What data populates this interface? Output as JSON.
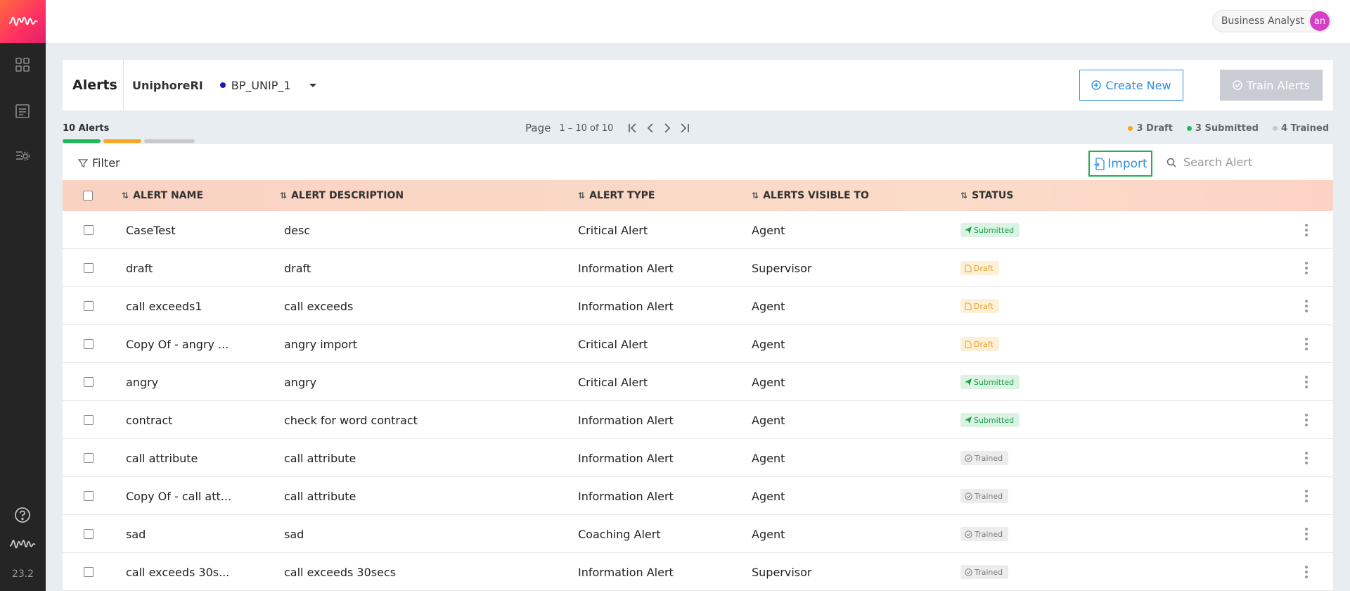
{
  "sidebar": {
    "icons": [
      "logo-icon",
      "dashboard-icon",
      "list-icon",
      "settings-list-icon"
    ],
    "version": "23.2"
  },
  "topbar": {
    "role": "Business Analyst",
    "avatar_initials": "an"
  },
  "header": {
    "title": "Alerts",
    "project": "UniphoreRI",
    "workspace": "BP_UNIP_1",
    "create_label": "Create New",
    "train_label": "Train Alerts"
  },
  "summary": {
    "count_label": "10 Alerts",
    "page_label": "Page",
    "page_range": "1 – 10 of 10",
    "legend": [
      {
        "label": "3 Draft",
        "color": "#f5a623"
      },
      {
        "label": "3 Submitted",
        "color": "#1db954"
      },
      {
        "label": "4 Trained",
        "color": "#c8c8c8"
      }
    ]
  },
  "toolbar": {
    "filter_label": "Filter",
    "import_label": "Import",
    "search_placeholder": "Search Alert"
  },
  "table": {
    "columns": [
      "ALERT NAME",
      "ALERT DESCRIPTION",
      "ALERT TYPE",
      "ALERTS VISIBLE TO",
      "STATUS"
    ],
    "rows": [
      {
        "name": "CaseTest",
        "description": "desc",
        "type": "Critical Alert",
        "visible": "Agent",
        "status": "Submitted"
      },
      {
        "name": "draft",
        "description": "draft",
        "type": "Information Alert",
        "visible": "Supervisor",
        "status": "Draft"
      },
      {
        "name": "call exceeds1",
        "description": "call exceeds",
        "type": "Information Alert",
        "visible": "Agent",
        "status": "Draft"
      },
      {
        "name": "Copy Of - angry ...",
        "description": "angry import",
        "type": "Critical Alert",
        "visible": "Agent",
        "status": "Draft"
      },
      {
        "name": "angry",
        "description": "angry",
        "type": "Critical Alert",
        "visible": "Agent",
        "status": "Submitted"
      },
      {
        "name": "contract",
        "description": "check for word contract",
        "type": "Information Alert",
        "visible": "Agent",
        "status": "Submitted"
      },
      {
        "name": "call attribute",
        "description": "call attribute",
        "type": "Information Alert",
        "visible": "Agent",
        "status": "Trained"
      },
      {
        "name": "Copy Of - call att...",
        "description": "call attribute",
        "type": "Information Alert",
        "visible": "Agent",
        "status": "Trained"
      },
      {
        "name": "sad",
        "description": "sad",
        "type": "Coaching Alert",
        "visible": "Agent",
        "status": "Trained"
      },
      {
        "name": "call exceeds 30s...",
        "description": "call exceeds 30secs",
        "type": "Information Alert",
        "visible": "Supervisor",
        "status": "Trained"
      }
    ]
  }
}
